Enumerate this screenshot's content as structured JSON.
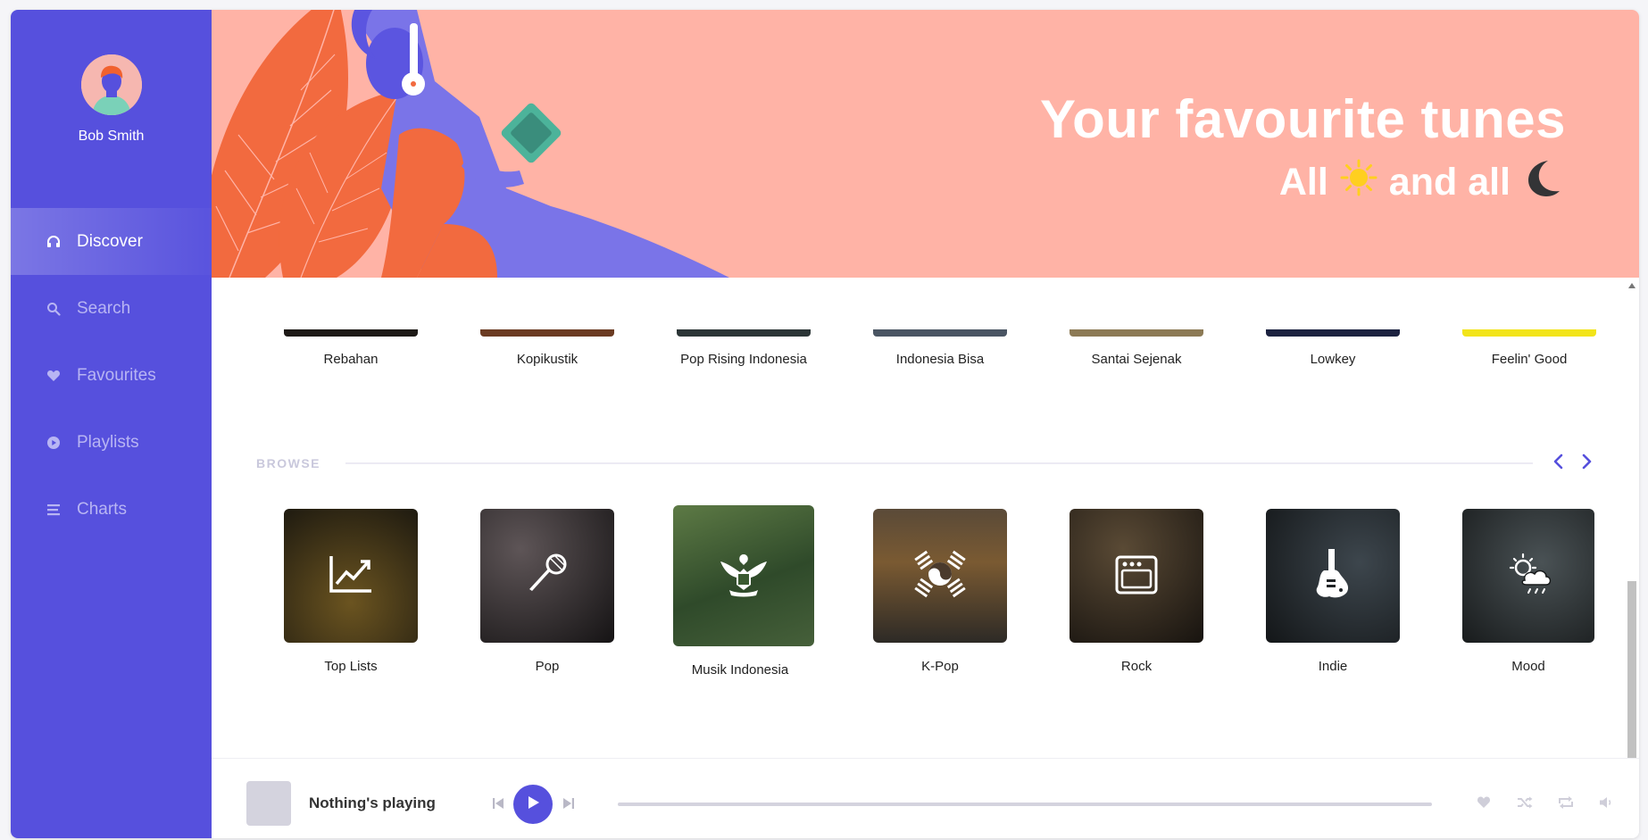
{
  "user": {
    "name": "Bob Smith"
  },
  "nav": {
    "items": [
      {
        "label": "Discover",
        "icon": "headphones-icon",
        "active": true
      },
      {
        "label": "Search",
        "icon": "search-icon",
        "active": false
      },
      {
        "label": "Favourites",
        "icon": "heart-icon",
        "active": false
      },
      {
        "label": "Playlists",
        "icon": "play-circle-icon",
        "active": false
      },
      {
        "label": "Charts",
        "icon": "list-icon",
        "active": false
      }
    ]
  },
  "banner": {
    "title": "Your favourite tunes",
    "subtitle_prefix": "All",
    "subtitle_middle": "and all",
    "sun_icon": "sun-icon",
    "moon_icon": "moon-icon"
  },
  "playlists_row": [
    {
      "label": "Rebahan",
      "color": "#1e1a17"
    },
    {
      "label": "Kopikustik",
      "color": "#6b3b22"
    },
    {
      "label": "Pop Rising Indonesia",
      "color": "#2b3536"
    },
    {
      "label": "Indonesia Bisa",
      "color": "#4a5563"
    },
    {
      "label": "Santai Sejenak",
      "color": "#8c7a55"
    },
    {
      "label": "Lowkey",
      "color": "#1c2240"
    },
    {
      "label": "Feelin' Good",
      "color": "#f2e41a"
    }
  ],
  "browse": {
    "heading": "BROWSE",
    "items": [
      {
        "label": "Top Lists",
        "icon": "trending-chart-icon",
        "bg": "#3a2f14"
      },
      {
        "label": "Pop",
        "icon": "microphone-icon",
        "bg": "#2d2a2c"
      },
      {
        "label": "Musik Indonesia",
        "icon": "garuda-icon",
        "bg": "#3f5a32"
      },
      {
        "label": "K-Pop",
        "icon": "taegeuk-icon",
        "bg": "#4a3a2c"
      },
      {
        "label": "Rock",
        "icon": "amplifier-icon",
        "bg": "#2d2721"
      },
      {
        "label": "Indie",
        "icon": "guitar-icon",
        "bg": "#1f2326"
      },
      {
        "label": "Mood",
        "icon": "weather-icon",
        "bg": "#2c3133"
      }
    ]
  },
  "player": {
    "title": "Nothing's playing",
    "progress": 0
  },
  "colors": {
    "accent": "#5650dd",
    "banner": "#ffb3a6",
    "sun": "#ffcf1f"
  }
}
